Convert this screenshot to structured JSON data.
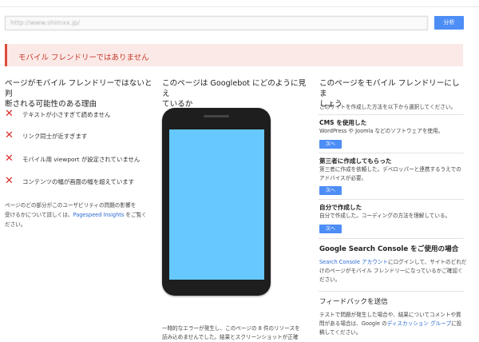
{
  "search": {
    "url_value": "http://www.shimxx.jp/",
    "analyze_label": "分析"
  },
  "banner": {
    "text": "モバイル フレンドリーではありません"
  },
  "left": {
    "title_line1": "ページがモバイル フレンドリーではないと判",
    "title_line2": "断される可能性のある理由",
    "issues": [
      {
        "label": "テキストが小さすぎて読めません"
      },
      {
        "label": "リンク同士が近すぎます"
      },
      {
        "label": "モバイル用 viewport が設定されていません"
      },
      {
        "label": "コンテンツの幅が画面の幅を超えています"
      }
    ],
    "note_line1": "ページのどの部分がこのユーザビリティの問題の影響を",
    "note_line2_pre": "受けるかについて詳しくは、",
    "note_link": "Pagespeed Insights",
    "note_line2_post": " をご覧く",
    "note_line3": "ださい。"
  },
  "middle": {
    "title_line1": "このページは Googlebot にどのように見え",
    "title_line2": "ているか",
    "bottom_line1": "一時的なエラーが発生し、このページの 8 件のリソースを",
    "bottom_line2": "読み込めませんでした。結果とスクリーンショットが正確"
  },
  "right": {
    "title_line1": "このページをモバイル フレンドリーにしま",
    "title_line2": "しょう",
    "intro": "このサイトを作成した方法を以下から選択してください。",
    "options": [
      {
        "title": "CMS を使用した",
        "desc_line1": "WordPress や Joomla などのソフトウェアを使用。",
        "desc_line2": "",
        "button": "次へ"
      },
      {
        "title": "第三者に作成してもらった",
        "desc_line1": "第三者に作成を依頼した。デベロッパーと連携するうえでの",
        "desc_line2": "アドバイスが必要。",
        "button": "次へ"
      },
      {
        "title": "自分で作成した",
        "desc_line1": "自分で作成した。コーディングの方法を理解している。",
        "desc_line2": "",
        "button": "次へ"
      }
    ],
    "gsc_title": "Google Search Console をご使用の場合",
    "gsc_link": "Search Console アカウント",
    "gsc_line1_post": "にログインして、サイトのどれだ",
    "gsc_line2": "けのページがモバイル フレンドリーになっているかご確認く",
    "gsc_line3": "ださい。",
    "feedback_title": "フィードバックを送信",
    "feedback_line1": "テストで問題が発生した場合や、結果についてコメントや質",
    "feedback_line2_pre": "問がある場合は、Google の",
    "feedback_link": "ディスカッション グループ",
    "feedback_line2_post": "に投",
    "feedback_line3": "稿してください。"
  }
}
